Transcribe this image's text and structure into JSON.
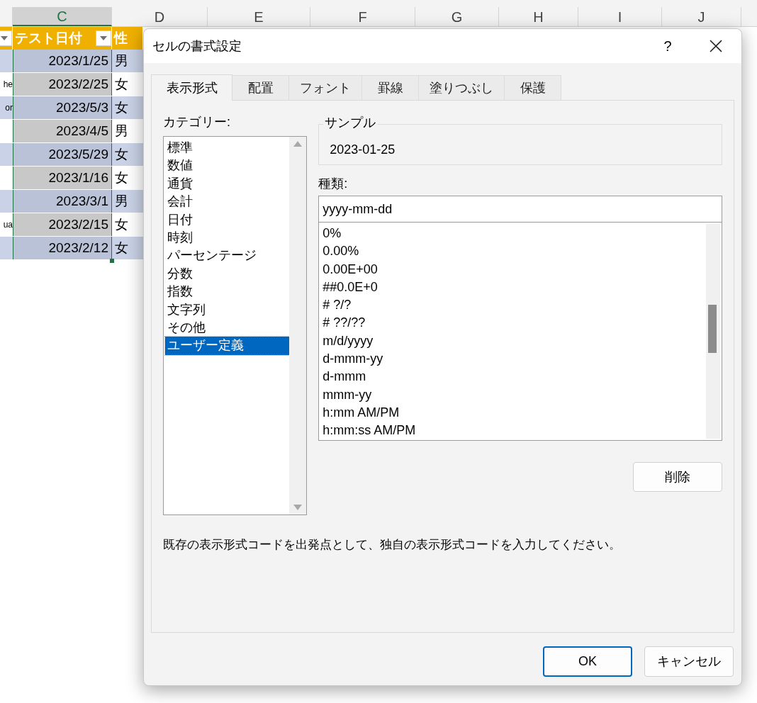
{
  "sheet": {
    "column_headers": [
      {
        "label": "C",
        "selected": true
      },
      {
        "label": "D",
        "selected": false
      },
      {
        "label": "E",
        "selected": false
      },
      {
        "label": "F",
        "selected": false
      },
      {
        "label": "G",
        "selected": false
      },
      {
        "label": "H",
        "selected": false
      },
      {
        "label": "I",
        "selected": false
      },
      {
        "label": "J",
        "selected": false
      }
    ],
    "header_cells": [
      {
        "filter": true
      },
      {
        "label": "テスト日付",
        "filter": true
      },
      {
        "label": "性",
        "filter": false
      }
    ],
    "rows": [
      {
        "date": "2023/1/25",
        "gender": "男"
      },
      {
        "column_b": "he",
        "date": "2023/2/25",
        "gender": "女"
      },
      {
        "column_b": "or",
        "date": "2023/5/3",
        "gender": "女"
      },
      {
        "date": "2023/4/5",
        "gender": "男"
      },
      {
        "date": "2023/5/29",
        "gender": "女"
      },
      {
        "date": "2023/1/16",
        "gender": "女"
      },
      {
        "date": "2023/3/1",
        "gender": "男"
      },
      {
        "column_b": "ua",
        "date": "2023/2/15",
        "gender": "女"
      },
      {
        "date": "2023/2/12",
        "gender": "女"
      }
    ]
  },
  "dialog": {
    "title": "セルの書式設定",
    "help": "?",
    "tabs": [
      {
        "label": "表示形式",
        "selected": true
      },
      {
        "label": "配置",
        "selected": false
      },
      {
        "label": "フォント",
        "selected": false
      },
      {
        "label": "罫線",
        "selected": false
      },
      {
        "label": "塗りつぶし",
        "selected": false
      },
      {
        "label": "保護",
        "selected": false
      }
    ],
    "category_label": "カテゴリー:",
    "categories": [
      {
        "label": "標準",
        "selected": false
      },
      {
        "label": "数値",
        "selected": false
      },
      {
        "label": "通貨",
        "selected": false
      },
      {
        "label": "会計",
        "selected": false
      },
      {
        "label": "日付",
        "selected": false
      },
      {
        "label": "時刻",
        "selected": false
      },
      {
        "label": "パーセンテージ",
        "selected": false
      },
      {
        "label": "分数",
        "selected": false
      },
      {
        "label": "指数",
        "selected": false
      },
      {
        "label": "文字列",
        "selected": false
      },
      {
        "label": "その他",
        "selected": false
      },
      {
        "label": "ユーザー定義",
        "selected": true
      }
    ],
    "sample_label": "サンプル",
    "sample_value": "2023-01-25",
    "type_label": "種類:",
    "type_value": "yyyy-mm-dd",
    "formats": [
      "0%",
      "0.00%",
      "0.00E+00",
      "##0.0E+0",
      "# ?/?",
      "# ??/??",
      "m/d/yyyy",
      "d-mmm-yy",
      "d-mmm",
      "mmm-yy",
      "h:mm AM/PM",
      "h:mm:ss AM/PM"
    ],
    "delete_button": "削除",
    "description": "既存の表示形式コードを出発点として、独自の表示形式コードを入力してください。",
    "buttons": [
      {
        "label": "OK",
        "kind": "default"
      },
      {
        "label": "キャンセル",
        "kind": "normal"
      }
    ]
  }
}
